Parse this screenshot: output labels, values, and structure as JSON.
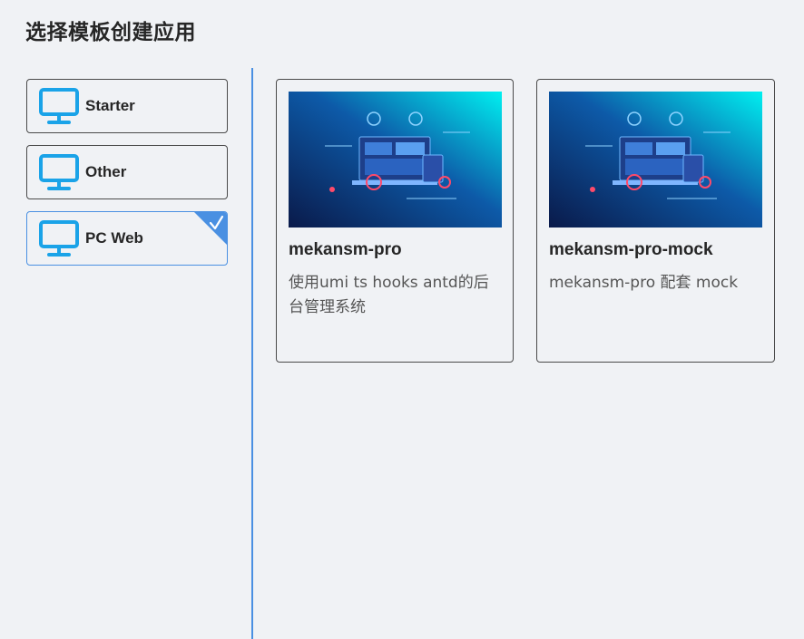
{
  "header": {
    "title": "选择模板创建应用"
  },
  "sidebar": {
    "items": [
      {
        "label": "Starter",
        "icon": "monitor-icon",
        "selected": false
      },
      {
        "label": "Other",
        "icon": "monitor-icon",
        "selected": false
      },
      {
        "label": "PC Web",
        "icon": "monitor-icon",
        "selected": true
      }
    ]
  },
  "templates": [
    {
      "title": "mekansm-pro",
      "description": "使用umi ts hooks antd的后台管理系统"
    },
    {
      "title": "mekansm-pro-mock",
      "description": "mekansm-pro 配套 mock"
    }
  ],
  "colors": {
    "accent": "#4a90e2",
    "icon": "#1aa3e8",
    "background": "#f0f2f5",
    "border": "#4a4a4a"
  }
}
